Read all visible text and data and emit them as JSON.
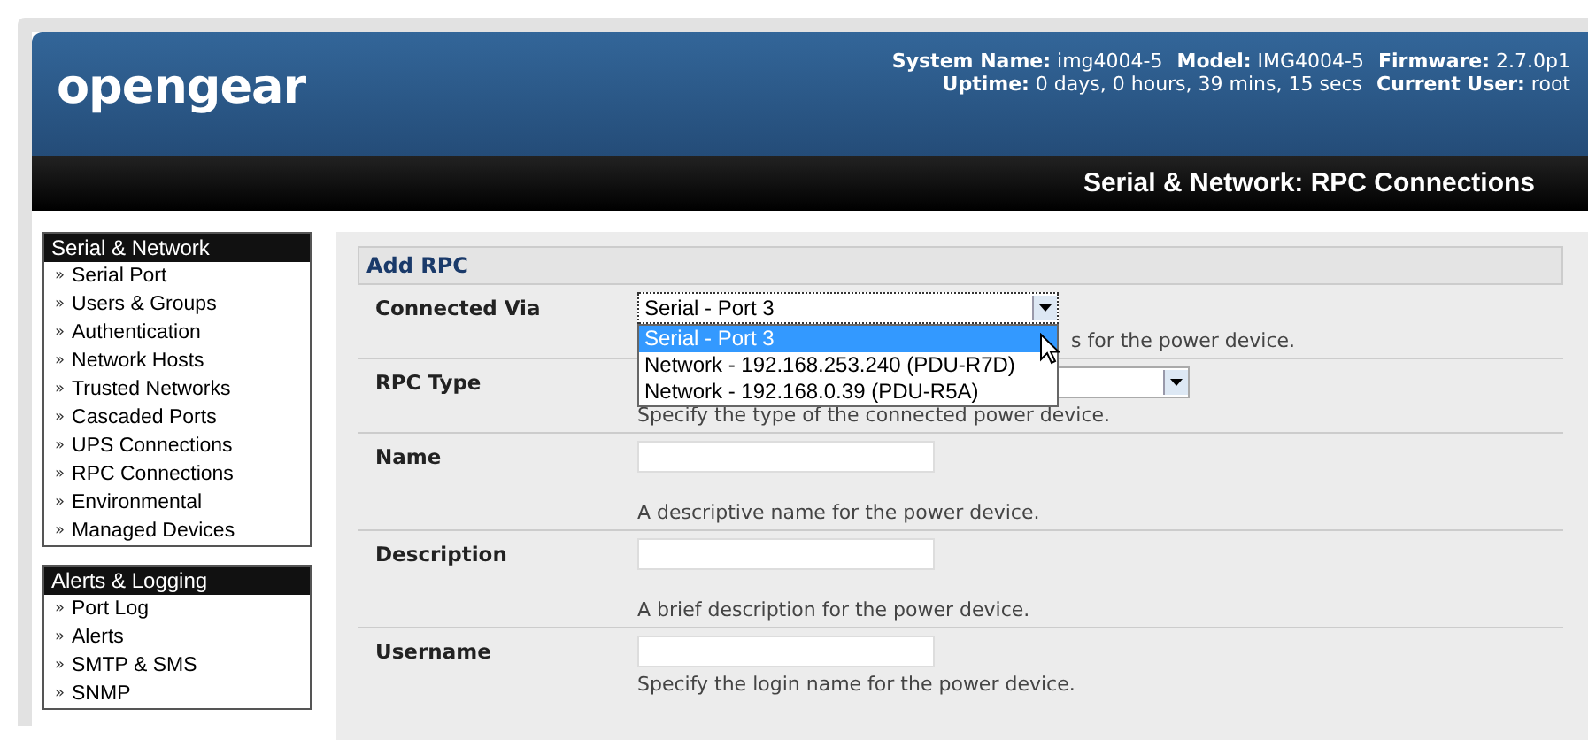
{
  "header": {
    "logo": "opengear",
    "info_lines": [
      [
        {
          "label": "System Name:",
          "value": "img4004-5"
        },
        {
          "label": "Model:",
          "value": "IMG4004-5"
        },
        {
          "label": "Firmware:",
          "value": "2.7.0p1"
        }
      ],
      [
        {
          "label": "Uptime:",
          "value": "0 days, 0 hours, 39 mins, 15 secs"
        },
        {
          "label": "Current User:",
          "value": "root"
        }
      ]
    ],
    "page_title": "Serial & Network: RPC Connections"
  },
  "sidebar": [
    {
      "title": "Serial & Network",
      "items": [
        {
          "label": "Serial Port"
        },
        {
          "label": "Users & Groups"
        },
        {
          "label": "Authentication"
        },
        {
          "label": "Network Hosts"
        },
        {
          "label": "Trusted Networks"
        },
        {
          "label": "Cascaded Ports"
        },
        {
          "label": "UPS Connections"
        },
        {
          "label": "RPC Connections"
        },
        {
          "label": "Environmental"
        },
        {
          "label": "Managed Devices"
        }
      ]
    },
    {
      "title": "Alerts & Logging",
      "items": [
        {
          "label": "Port Log"
        },
        {
          "label": "Alerts"
        },
        {
          "label": "SMTP & SMS"
        },
        {
          "label": "SNMP"
        }
      ]
    }
  ],
  "sidebar_bullet": "»",
  "form": {
    "title": "Add RPC",
    "rows": [
      {
        "label": "Connected Via",
        "kind": "select",
        "value": "Serial - Port 3",
        "help": "s for the power device.",
        "expanded": true,
        "options": [
          {
            "label": "Serial - Port 3",
            "selected": true
          },
          {
            "label": "Network - 192.168.253.240 (PDU-R7D)",
            "selected": false
          },
          {
            "label": "Network - 192.168.0.39 (PDU-R5A)",
            "selected": false
          }
        ]
      },
      {
        "label": "RPC Type",
        "kind": "select",
        "help": "Specify the type of the connected power device.",
        "expanded": false
      },
      {
        "label": "Name",
        "kind": "text",
        "help": "A descriptive name for the power device."
      },
      {
        "label": "Description",
        "kind": "text",
        "help": "A brief description for the power device."
      },
      {
        "label": "Username",
        "kind": "text",
        "help": "Specify the login name for the power device."
      }
    ]
  }
}
